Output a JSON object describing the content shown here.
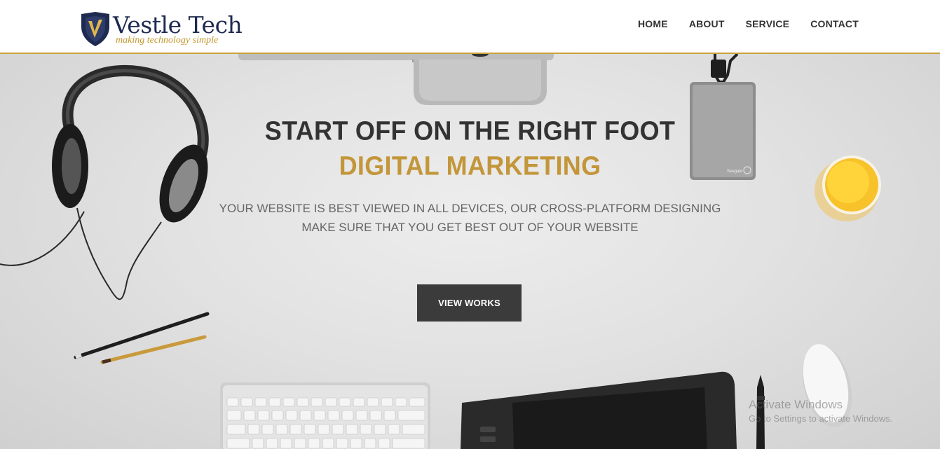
{
  "brand": {
    "name": "Vestle Tech",
    "tagline": "making technology simple"
  },
  "nav": {
    "items": [
      "HOME",
      "ABOUT",
      "SERVICE",
      "CONTACT"
    ]
  },
  "hero": {
    "title_line1": "START OFF ON THE RIGHT FOOT",
    "title_line2": "DIGITAL MARKETING",
    "subtitle_line1": "YOUR WEBSITE IS BEST VIEWED IN ALL DEVICES, OUR CROSS-PLATFORM DESIGNING",
    "subtitle_line2": "MAKE SURE THAT YOU GET BEST OUT OF YOUR WEBSITE",
    "cta_label": "VIEW WORKS"
  },
  "drive_label": "Seagate",
  "watermark": {
    "line1": "Activate Windows",
    "line2": "Go to Settings to activate Windows."
  },
  "colors": {
    "accent": "#c3963a",
    "navy": "#1e2a4f",
    "button": "#3b3b3b"
  }
}
